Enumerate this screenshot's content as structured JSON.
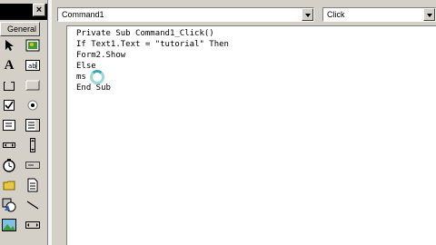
{
  "toolbox": {
    "tab_label": "General",
    "close_label": "×",
    "tools": [
      {
        "name": "pointer-icon"
      },
      {
        "name": "picturebox-icon"
      },
      {
        "name": "label-icon",
        "glyph": "A"
      },
      {
        "name": "textbox-icon",
        "glyph": "ab|"
      },
      {
        "name": "frame-icon"
      },
      {
        "name": "commandbutton-icon"
      },
      {
        "name": "checkbox-icon"
      },
      {
        "name": "optionbutton-icon"
      },
      {
        "name": "combobox-icon"
      },
      {
        "name": "listbox-icon"
      },
      {
        "name": "hscrollbar-icon"
      },
      {
        "name": "vscrollbar-icon"
      },
      {
        "name": "timer-icon"
      },
      {
        "name": "drivelistbox-icon"
      },
      {
        "name": "dirlistbox-icon"
      },
      {
        "name": "filelistbox-icon"
      },
      {
        "name": "shape-icon"
      },
      {
        "name": "line-icon"
      },
      {
        "name": "image-icon"
      },
      {
        "name": "data-icon"
      }
    ]
  },
  "code_window": {
    "object_combo": "Command1",
    "procedure_combo": "Click",
    "lines": [
      "Private Sub Command1_Click()",
      "If Text1.Text = \"tutorial\" Then",
      "Form2.Show",
      "Else",
      "ms",
      "End Sub"
    ]
  },
  "colors": {
    "chrome": "#d4d0c8",
    "editor_bg": "#ffffff",
    "spinner": "#3aa8b0"
  }
}
